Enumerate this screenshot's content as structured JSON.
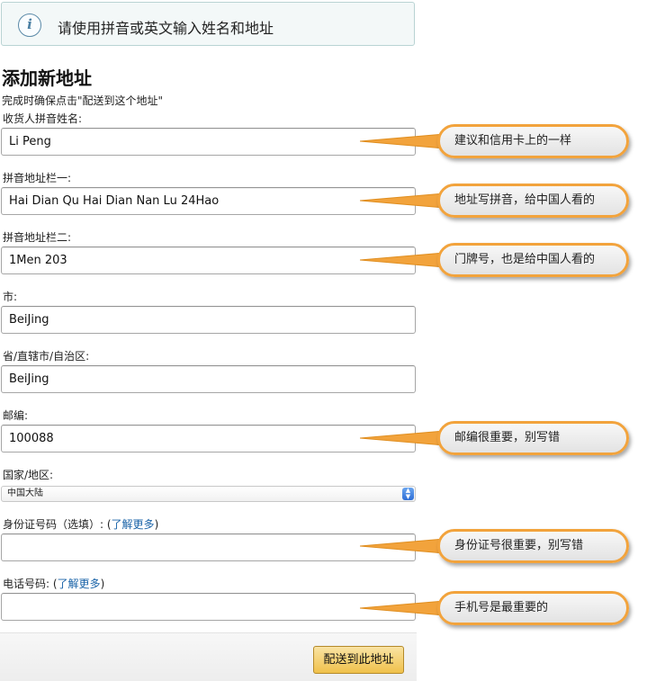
{
  "notice": {
    "icon": "info-icon",
    "text": "请使用拼音或英文输入姓名和地址"
  },
  "page": {
    "title": "添加新地址",
    "subtitle": "完成时确保点击\"配送到这个地址\""
  },
  "form": {
    "name_label": "收货人拼音姓名:",
    "name_value": "Li Peng",
    "address1_label": "拼音地址栏一:",
    "address1_value": "Hai Dian Qu Hai Dian Nan Lu 24Hao",
    "address2_label": "拼音地址栏二:",
    "address2_value": "1Men 203",
    "city_label": "市:",
    "city_value": "BeiJing",
    "state_label": "省/直辖市/自治区:",
    "state_value": "BeiJing",
    "zip_label": "邮编:",
    "zip_value": "100088",
    "country_label": "国家/地区:",
    "country_value": "中国大陆",
    "id_label": "身份证号码（选填）: ",
    "id_link_open": "(",
    "id_link": "了解更多",
    "id_link_close": ")",
    "id_value": "",
    "phone_label": "电话号码: ",
    "phone_link_open": "(",
    "phone_link": "了解更多",
    "phone_link_close": ")",
    "phone_value": ""
  },
  "submit_label": "配送到此地址",
  "callouts": {
    "name": "建议和信用卡上的一样",
    "address1": "地址写拼音，给中国人看的",
    "address2": "门牌号，也是给中国人看的",
    "zip": "邮编很重要，别写错",
    "id": "身份证号很重要，别写错",
    "phone": "手机号是最重要的"
  },
  "colors": {
    "callout_border": "#f2a33c",
    "link": "#1a63a8",
    "button_top": "#f9e3a3",
    "button_bottom": "#f0c14b"
  }
}
